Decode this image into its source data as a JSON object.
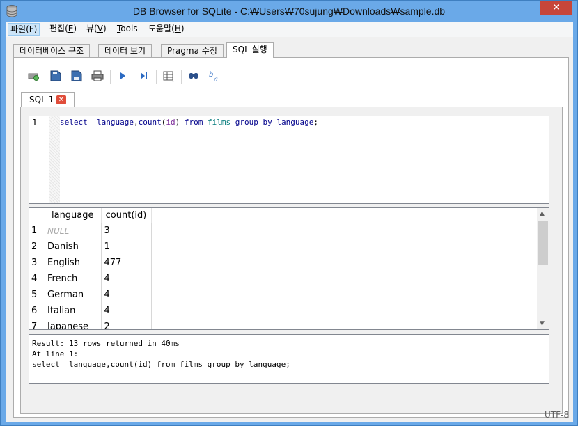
{
  "window": {
    "title": "DB Browser for SQLite - C:\\Users\\70sujung\\Downloads\\sample.db",
    "title_display": "DB Browser for SQLite - C:₩Users₩70sujung₩Downloads₩sample.db",
    "close_glyph": "✕"
  },
  "menu": [
    {
      "label": "파일(",
      "key": "F",
      "tail": ")"
    },
    {
      "label": "편집(",
      "key": "E",
      "tail": ")"
    },
    {
      "label": "뷰(",
      "key": "V",
      "tail": ")"
    },
    {
      "label": "",
      "key": "T",
      "tail": "ools"
    },
    {
      "label": "도움말(",
      "key": "H",
      "tail": ")"
    }
  ],
  "tabs": [
    "데이터베이스 구조",
    "데이터 보기",
    "Pragma 수정",
    "SQL 실행"
  ],
  "toolbar": [
    "open-tab-icon",
    "open-sql-icon",
    "save-sql-icon",
    "print-icon",
    "execute-all-icon",
    "execute-line-icon",
    "save-results-icon",
    "find-icon",
    "find-replace-icon"
  ],
  "sql_tab": {
    "label": "SQL 1",
    "close": "✕"
  },
  "editor": {
    "line_number": "1",
    "tokens": {
      "select": "select",
      "sp1": "  ",
      "language": "language",
      "comma": ",",
      "count": "count",
      "lp": "(",
      "id": "id",
      "rp": ")",
      "from": "from",
      "films": "films",
      "group": "group",
      "by": "by",
      "language2": "language",
      "semi": ";"
    }
  },
  "grid": {
    "columns": [
      "language",
      "count(id)"
    ],
    "rows": [
      {
        "n": "1",
        "language": "NULL",
        "count": "3"
      },
      {
        "n": "2",
        "language": "Danish",
        "count": "1"
      },
      {
        "n": "3",
        "language": "English",
        "count": "477"
      },
      {
        "n": "4",
        "language": "French",
        "count": "4"
      },
      {
        "n": "5",
        "language": "German",
        "count": "4"
      },
      {
        "n": "6",
        "language": "Italian",
        "count": "4"
      },
      {
        "n": "7",
        "language": "Japanese",
        "count": "2"
      }
    ]
  },
  "result": {
    "line1": "Result: 13 rows returned in 40ms",
    "line2": "At line 1:",
    "line3": "select  language,count(id) from films group by language;"
  },
  "status": {
    "encoding": "UTF-8"
  }
}
